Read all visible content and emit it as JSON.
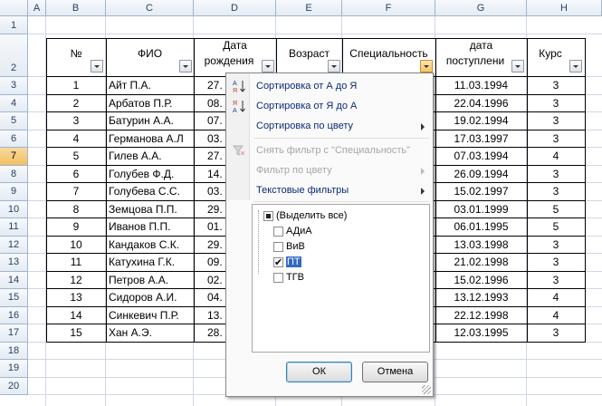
{
  "columns": [
    "A",
    "B",
    "C",
    "D",
    "E",
    "F",
    "G",
    "H"
  ],
  "rows": [
    "1",
    "2",
    "3",
    "4",
    "5",
    "6",
    "7",
    "8",
    "9",
    "10",
    "11",
    "12",
    "13",
    "14",
    "15",
    "16",
    "17",
    "18",
    "19",
    "20"
  ],
  "selected_row": "7",
  "table": {
    "headers": {
      "num": "№",
      "fio": "ФИО",
      "dob_line1": "Дата",
      "dob_line2": "рождения",
      "age": "Возраст",
      "spec": "Специальность",
      "enroll_line1": "дата",
      "enroll_line2": "поступлени",
      "course": "Курс"
    },
    "rows": [
      {
        "num": "1",
        "fio": "Айт П.А.",
        "dob": "27.",
        "enroll": "11.03.1994",
        "course": "3"
      },
      {
        "num": "2",
        "fio": "Арбатов П.Р.",
        "dob": "08.",
        "enroll": "22.04.1996",
        "course": "3"
      },
      {
        "num": "3",
        "fio": "Батурин А.А.",
        "dob": "07.",
        "enroll": "19.02.1994",
        "course": "3"
      },
      {
        "num": "4",
        "fio": "Германова А.Л",
        "dob": "03.",
        "enroll": "17.03.1997",
        "course": "3"
      },
      {
        "num": "5",
        "fio": "Гилев А.А.",
        "dob": "27.",
        "enroll": "07.03.1994",
        "course": "4"
      },
      {
        "num": "6",
        "fio": "Голубев Ф.Д.",
        "dob": "14.",
        "enroll": "26.09.1994",
        "course": "3"
      },
      {
        "num": "7",
        "fio": "Голубева С.С.",
        "dob": "03.",
        "enroll": "15.02.1997",
        "course": "3"
      },
      {
        "num": "8",
        "fio": "Земцова П.П.",
        "dob": "29.",
        "enroll": "03.01.1999",
        "course": "5"
      },
      {
        "num": "9",
        "fio": "Иванов П.П.",
        "dob": "01.",
        "enroll": "06.01.1995",
        "course": "5"
      },
      {
        "num": "10",
        "fio": "Кандаков С.К.",
        "dob": "29.",
        "enroll": "13.03.1998",
        "course": "3"
      },
      {
        "num": "11",
        "fio": "Катухина Г.К.",
        "dob": "09.",
        "enroll": "21.02.1998",
        "course": "3"
      },
      {
        "num": "12",
        "fio": "Петров А.А.",
        "dob": "02.",
        "enroll": "15.02.1996",
        "course": "3"
      },
      {
        "num": "13",
        "fio": "Сидоров А.И.",
        "dob": "04.",
        "enroll": "13.12.1993",
        "course": "4"
      },
      {
        "num": "14",
        "fio": "Синкевич П.Р.",
        "dob": "13.",
        "enroll": "22.12.1998",
        "course": "4"
      },
      {
        "num": "15",
        "fio": "Хан А.Э.",
        "dob": "28.",
        "enroll": "12.03.1995",
        "course": "3"
      }
    ]
  },
  "filter_menu": {
    "sort_az": "Сортировка от А до Я",
    "sort_za": "Сортировка от Я до А",
    "sort_color": "Сортировка по цвету",
    "clear_filter": "Снять фильтр с \"Специальность\"",
    "filter_color": "Фильтр по цвету",
    "text_filters": "Текстовые фильтры",
    "checklist": [
      {
        "label": "(Выделить все)",
        "state": "partial"
      },
      {
        "label": "АДиА",
        "state": "unchecked"
      },
      {
        "label": "ВиВ",
        "state": "unchecked"
      },
      {
        "label": "ПТ",
        "state": "checked"
      },
      {
        "label": "ТГВ",
        "state": "unchecked"
      }
    ],
    "ok_label": "ОК",
    "cancel_label": "Отмена"
  },
  "icons": {
    "sort_az": "sort-az-icon",
    "sort_za": "sort-za-icon",
    "clear_filter": "funnel-clear-icon",
    "filter_button": "dropdown-arrow-icon"
  },
  "colors": {
    "header_bg": "#e4ebf4",
    "selection": "#f1c15f",
    "menu_text": "#0b2a78",
    "highlight": "#316ac5"
  }
}
